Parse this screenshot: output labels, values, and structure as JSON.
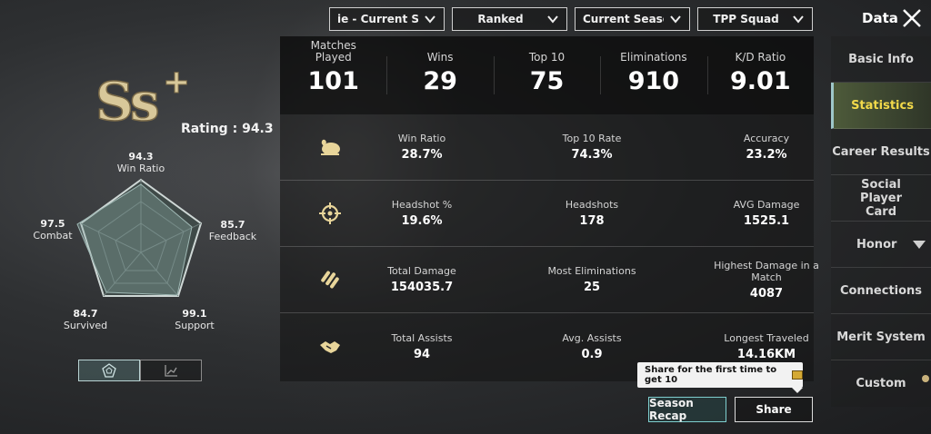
{
  "filters": [
    {
      "label": "ie - Current Serv"
    },
    {
      "label": "Ranked"
    },
    {
      "label": "Current Season"
    },
    {
      "label": "TPP Squad"
    }
  ],
  "header": {
    "title": "Data"
  },
  "nav": {
    "items": [
      {
        "label": "Basic Info"
      },
      {
        "label": "Statistics"
      },
      {
        "label": "Career Results"
      },
      {
        "label": "Social Player Card"
      },
      {
        "label": "Honor"
      },
      {
        "label": "Connections"
      },
      {
        "label": "Merit System"
      },
      {
        "label": "Custom"
      }
    ]
  },
  "rank": {
    "tier": "Ss+",
    "rating_label": "Rating",
    "rating_sep": ":",
    "rating_value": "94.3"
  },
  "radar": {
    "axes": [
      {
        "name": "Win Ratio",
        "value": "94.3"
      },
      {
        "name": "Feedback",
        "value": "85.7"
      },
      {
        "name": "Support",
        "value": "99.1"
      },
      {
        "name": "Survived",
        "value": "84.7"
      },
      {
        "name": "Combat",
        "value": "97.5"
      }
    ]
  },
  "summary": [
    {
      "label": "Matches Played",
      "value": "101"
    },
    {
      "label": "Wins",
      "value": "29"
    },
    {
      "label": "Top 10",
      "value": "75"
    },
    {
      "label": "Eliminations",
      "value": "910"
    },
    {
      "label": "K/D Ratio",
      "value": "9.01"
    }
  ],
  "rows": [
    {
      "icon": "chicken-icon",
      "cells": [
        {
          "label": "Win Ratio",
          "value": "28.7%"
        },
        {
          "label": "Top 10 Rate",
          "value": "74.3%"
        },
        {
          "label": "Accuracy",
          "value": "23.2%"
        }
      ]
    },
    {
      "icon": "crosshair-icon",
      "cells": [
        {
          "label": "Headshot %",
          "value": "19.6%"
        },
        {
          "label": "Headshots",
          "value": "178"
        },
        {
          "label": "AVG Damage",
          "value": "1525.1"
        }
      ]
    },
    {
      "icon": "bullets-icon",
      "cells": [
        {
          "label": "Total Damage",
          "value": "154035.7"
        },
        {
          "label": "Most Eliminations",
          "value": "25"
        },
        {
          "label": "Highest Damage in a Match",
          "value": "4087"
        }
      ]
    },
    {
      "icon": "handshake-icon",
      "cells": [
        {
          "label": "Total Assists",
          "value": "94"
        },
        {
          "label": "Avg. Assists",
          "value": "0.9"
        },
        {
          "label": "Longest Traveled",
          "value": "14.16KM"
        }
      ]
    }
  ],
  "share": {
    "tooltip": "Share for the first time to get 10",
    "recap_label": "Season Recap",
    "share_label": "Share"
  },
  "colors": {
    "accent_yellow": "#f2d94a",
    "accent_teal": "#7fcfcf",
    "rank_gold": "#d8c89a"
  }
}
